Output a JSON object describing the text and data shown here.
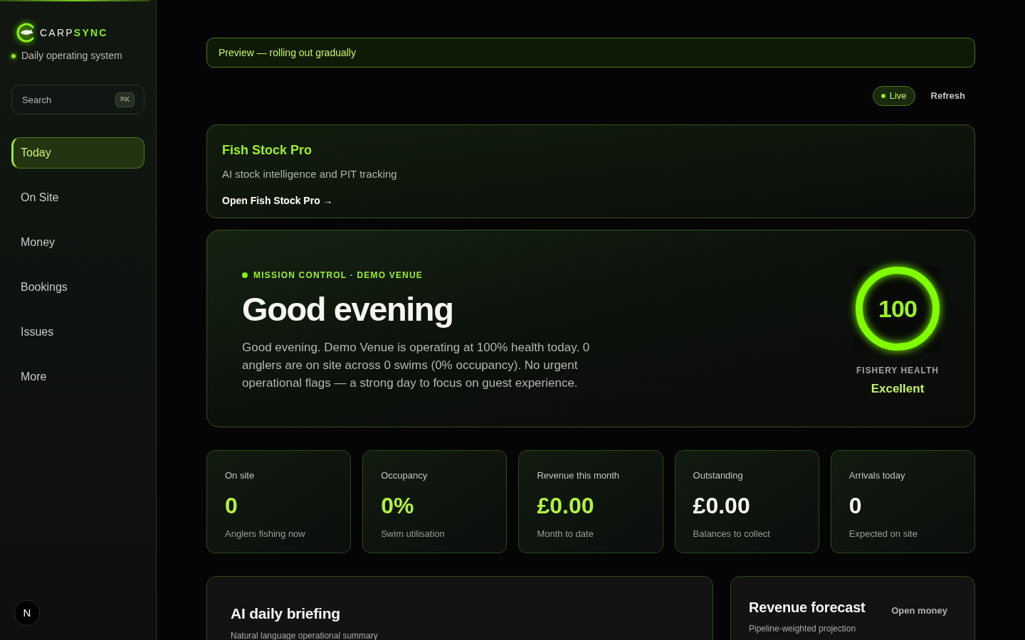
{
  "sidebar": {
    "logo": {
      "word_1": "CARP",
      "word_2": "SYNC"
    },
    "tagline": "Daily operating system",
    "search": {
      "placeholder": "Search",
      "shortcut": "⌘K"
    },
    "nav": [
      {
        "label": "Today",
        "selected": true
      },
      {
        "label": "On Site",
        "selected": false
      },
      {
        "label": "Money",
        "selected": false
      },
      {
        "label": "Bookings",
        "selected": false
      },
      {
        "label": "Issues",
        "selected": false
      },
      {
        "label": "More",
        "selected": false
      }
    ],
    "dev_badge": "N"
  },
  "banner": "Preview — rolling out gradually",
  "toolbar": {
    "live": "Live",
    "refresh": "Refresh"
  },
  "feature_card": {
    "title": "Fish Stock Pro",
    "subtitle": "AI stock intelligence and PIT tracking",
    "link": "Open Fish Stock Pro →"
  },
  "hero": {
    "eyebrow": "MISSION CONTROL · DEMO VENUE",
    "heading": "Good evening",
    "summary": "Good evening. Demo Venue is operating at 100% health today. 0 anglers are on site across 0 swims (0% occupancy). No urgent operational flags — a strong day to focus on guest experience.",
    "health": {
      "score": "100",
      "level": 1,
      "label": "FISHERY HEALTH",
      "rating": "Excellent"
    }
  },
  "stats": [
    {
      "label": "On site",
      "value": "0",
      "caption": "Anglers fishing now",
      "highlighted": true
    },
    {
      "label": "Occupancy",
      "value": "0%",
      "caption": "Swim utilisation",
      "highlighted": true
    },
    {
      "label": "Revenue this month",
      "value": "£0.00",
      "caption": "Month to date",
      "highlighted": true
    },
    {
      "label": "Outstanding",
      "value": "£0.00",
      "caption": "Balances to collect",
      "highlighted": false
    },
    {
      "label": "Arrivals today",
      "value": "0",
      "caption": "Expected on site",
      "highlighted": false
    }
  ],
  "briefing": {
    "title": "AI daily briefing",
    "subtitle": "Natural language operational summary"
  },
  "forecast": {
    "title": "Revenue forecast",
    "subtitle": "Pipeline-weighted projection",
    "action": "Open money"
  }
}
